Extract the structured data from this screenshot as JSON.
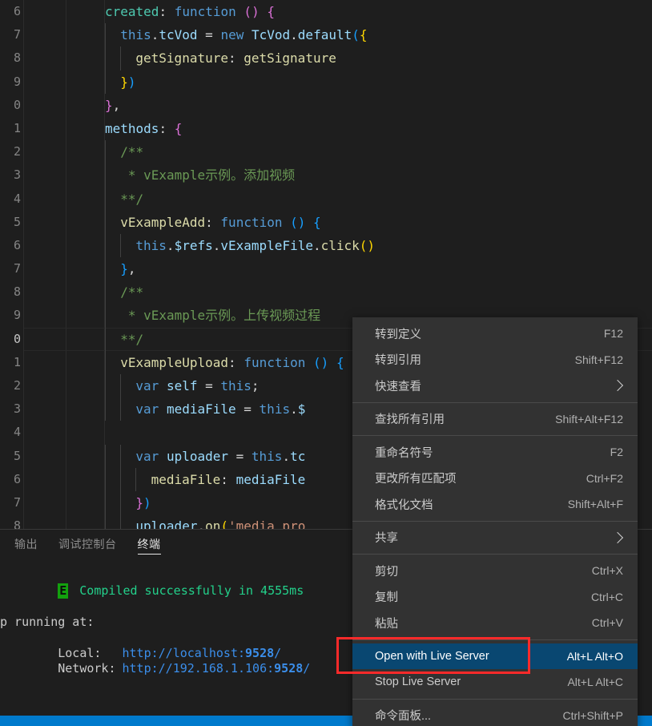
{
  "editor": {
    "language": "javascript",
    "lines": [
      {
        "num": "6",
        "indent": 0,
        "tokens": [
          {
            "t": "created",
            "c": "grn"
          },
          {
            "t": ":",
            "c": "pl"
          },
          {
            "t": " ",
            "c": "pl"
          },
          {
            "t": "function",
            "c": "kw"
          },
          {
            "t": " ",
            "c": "pl"
          },
          {
            "t": "(",
            "c": "p2"
          },
          {
            "t": ")",
            "c": "p2"
          },
          {
            "t": " ",
            "c": "pl"
          },
          {
            "t": "{",
            "c": "p2"
          }
        ]
      },
      {
        "num": "7",
        "indent": 1,
        "tokens": [
          {
            "t": "this",
            "c": "kw"
          },
          {
            "t": ".",
            "c": "pl"
          },
          {
            "t": "tcVod",
            "c": "key"
          },
          {
            "t": " = ",
            "c": "pl"
          },
          {
            "t": "new",
            "c": "kw"
          },
          {
            "t": " ",
            "c": "pl"
          },
          {
            "t": "TcVod",
            "c": "key"
          },
          {
            "t": ".",
            "c": "pl"
          },
          {
            "t": "default",
            "c": "key"
          },
          {
            "t": "(",
            "c": "p3"
          },
          {
            "t": "{",
            "c": "p1"
          }
        ]
      },
      {
        "num": "8",
        "indent": 2,
        "tokens": [
          {
            "t": "getSignature",
            "c": "fn"
          },
          {
            "t": ": ",
            "c": "pl"
          },
          {
            "t": "getSignature",
            "c": "fn"
          }
        ]
      },
      {
        "num": "9",
        "indent": 1,
        "tokens": [
          {
            "t": "}",
            "c": "p1"
          },
          {
            "t": ")",
            "c": "p3"
          }
        ]
      },
      {
        "num": "0",
        "indent": 0,
        "tokens": [
          {
            "t": "}",
            "c": "p2"
          },
          {
            "t": ",",
            "c": "pl"
          }
        ]
      },
      {
        "num": "1",
        "indent": 0,
        "tokens": [
          {
            "t": "methods",
            "c": "key"
          },
          {
            "t": ": ",
            "c": "pl"
          },
          {
            "t": "{",
            "c": "p2"
          }
        ]
      },
      {
        "num": "2",
        "indent": 1,
        "tokens": [
          {
            "t": "/**",
            "c": "cmt"
          }
        ]
      },
      {
        "num": "3",
        "indent": 1,
        "tokens": [
          {
            "t": " * vExample示例。添加视频",
            "c": "cmt"
          }
        ]
      },
      {
        "num": "4",
        "indent": 1,
        "tokens": [
          {
            "t": "**/",
            "c": "cmt"
          }
        ]
      },
      {
        "num": "5",
        "indent": 1,
        "tokens": [
          {
            "t": "vExampleAdd",
            "c": "fn"
          },
          {
            "t": ": ",
            "c": "pl"
          },
          {
            "t": "function",
            "c": "kw"
          },
          {
            "t": " ",
            "c": "pl"
          },
          {
            "t": "(",
            "c": "p3"
          },
          {
            "t": ")",
            "c": "p3"
          },
          {
            "t": " ",
            "c": "pl"
          },
          {
            "t": "{",
            "c": "p3"
          }
        ]
      },
      {
        "num": "6",
        "indent": 2,
        "tokens": [
          {
            "t": "this",
            "c": "kw"
          },
          {
            "t": ".",
            "c": "pl"
          },
          {
            "t": "$refs",
            "c": "key"
          },
          {
            "t": ".",
            "c": "pl"
          },
          {
            "t": "vExampleFile",
            "c": "key"
          },
          {
            "t": ".",
            "c": "pl"
          },
          {
            "t": "click",
            "c": "fn"
          },
          {
            "t": "(",
            "c": "p1"
          },
          {
            "t": ")",
            "c": "p1"
          }
        ]
      },
      {
        "num": "7",
        "indent": 1,
        "tokens": [
          {
            "t": "}",
            "c": "p3"
          },
          {
            "t": ",",
            "c": "pl"
          }
        ]
      },
      {
        "num": "8",
        "indent": 1,
        "tokens": [
          {
            "t": "/**",
            "c": "cmt"
          }
        ]
      },
      {
        "num": "9",
        "indent": 1,
        "tokens": [
          {
            "t": " * vExample示例。上传视频过程",
            "c": "cmt"
          }
        ]
      },
      {
        "num": "0",
        "indent": 1,
        "tokens": [
          {
            "t": "**/",
            "c": "cmt"
          }
        ],
        "current": true
      },
      {
        "num": "1",
        "indent": 1,
        "tokens": [
          {
            "t": "vExampleUpload",
            "c": "fn"
          },
          {
            "t": ": ",
            "c": "pl"
          },
          {
            "t": "function",
            "c": "kw"
          },
          {
            "t": " ",
            "c": "pl"
          },
          {
            "t": "(",
            "c": "p3"
          },
          {
            "t": ")",
            "c": "p3"
          },
          {
            "t": " ",
            "c": "pl"
          },
          {
            "t": "{",
            "c": "p3"
          }
        ]
      },
      {
        "num": "2",
        "indent": 2,
        "tokens": [
          {
            "t": "var",
            "c": "kw"
          },
          {
            "t": " ",
            "c": "pl"
          },
          {
            "t": "self",
            "c": "key"
          },
          {
            "t": " = ",
            "c": "pl"
          },
          {
            "t": "this",
            "c": "kw"
          },
          {
            "t": ";",
            "c": "pl"
          }
        ]
      },
      {
        "num": "3",
        "indent": 2,
        "tokens": [
          {
            "t": "var",
            "c": "kw"
          },
          {
            "t": " ",
            "c": "pl"
          },
          {
            "t": "mediaFile",
            "c": "key"
          },
          {
            "t": " = ",
            "c": "pl"
          },
          {
            "t": "this",
            "c": "kw"
          },
          {
            "t": ".",
            "c": "pl"
          },
          {
            "t": "$",
            "c": "key"
          }
        ]
      },
      {
        "num": "4",
        "indent": 0,
        "tokens": []
      },
      {
        "num": "5",
        "indent": 2,
        "tokens": [
          {
            "t": "var",
            "c": "kw"
          },
          {
            "t": " ",
            "c": "pl"
          },
          {
            "t": "uploader",
            "c": "key"
          },
          {
            "t": " = ",
            "c": "pl"
          },
          {
            "t": "this",
            "c": "kw"
          },
          {
            "t": ".",
            "c": "pl"
          },
          {
            "t": "tc",
            "c": "key"
          }
        ]
      },
      {
        "num": "6",
        "indent": 3,
        "tokens": [
          {
            "t": "mediaFile",
            "c": "fn"
          },
          {
            "t": ": ",
            "c": "pl"
          },
          {
            "t": "mediaFile",
            "c": "key"
          }
        ]
      },
      {
        "num": "7",
        "indent": 2,
        "tokens": [
          {
            "t": "}",
            "c": "p2"
          },
          {
            "t": ")",
            "c": "p3"
          }
        ]
      },
      {
        "num": "8",
        "indent": 2,
        "tokens": [
          {
            "t": "uploader",
            "c": "key"
          },
          {
            "t": ".",
            "c": "pl"
          },
          {
            "t": "on",
            "c": "fn"
          },
          {
            "t": "(",
            "c": "p1"
          },
          {
            "t": "'media_pro",
            "c": "str"
          }
        ]
      }
    ]
  },
  "panel": {
    "tabs": [
      {
        "label": "输出",
        "name": "tab-output",
        "active": false
      },
      {
        "label": "调试控制台",
        "name": "tab-debug-console",
        "active": false
      },
      {
        "label": "终端",
        "name": "tab-terminal",
        "active": true
      }
    ],
    "terminal": {
      "badge": "E",
      "compiled_message": "Compiled successfully in 4555ms",
      "running_line": "p running at:",
      "local_label": "Local:  ",
      "local_url_scheme": "http://localhost:",
      "local_port": "9528",
      "local_url_tail": "/",
      "network_label": "Network:",
      "network_url_scheme": "http://192.168.1.106:",
      "network_port": "9528",
      "network_url_tail": "/"
    }
  },
  "context_menu": {
    "groups": [
      {
        "items": [
          {
            "label": "转到定义",
            "key": "F12",
            "name": "menu-go-to-definition",
            "submenu": false,
            "selected": false
          },
          {
            "label": "转到引用",
            "key": "Shift+F12",
            "name": "menu-go-to-references",
            "submenu": false,
            "selected": false
          },
          {
            "label": "快速查看",
            "key": "",
            "name": "menu-peek",
            "submenu": true,
            "selected": false
          }
        ]
      },
      {
        "items": [
          {
            "label": "查找所有引用",
            "key": "Shift+Alt+F12",
            "name": "menu-find-all-references",
            "submenu": false,
            "selected": false
          }
        ]
      },
      {
        "items": [
          {
            "label": "重命名符号",
            "key": "F2",
            "name": "menu-rename-symbol",
            "submenu": false,
            "selected": false
          },
          {
            "label": "更改所有匹配项",
            "key": "Ctrl+F2",
            "name": "menu-change-all-occurrences",
            "submenu": false,
            "selected": false
          },
          {
            "label": "格式化文档",
            "key": "Shift+Alt+F",
            "name": "menu-format-document",
            "submenu": false,
            "selected": false
          }
        ]
      },
      {
        "items": [
          {
            "label": "共享",
            "key": "",
            "name": "menu-share",
            "submenu": true,
            "selected": false
          }
        ]
      },
      {
        "items": [
          {
            "label": "剪切",
            "key": "Ctrl+X",
            "name": "menu-cut",
            "submenu": false,
            "selected": false
          },
          {
            "label": "复制",
            "key": "Ctrl+C",
            "name": "menu-copy",
            "submenu": false,
            "selected": false
          },
          {
            "label": "粘贴",
            "key": "Ctrl+V",
            "name": "menu-paste",
            "submenu": false,
            "selected": false
          }
        ]
      },
      {
        "items": [
          {
            "label": "Open with Live Server",
            "key": "Alt+L Alt+O",
            "name": "menu-open-with-live-server",
            "submenu": false,
            "selected": true
          },
          {
            "label": "Stop Live Server",
            "key": "Alt+L Alt+C",
            "name": "menu-stop-live-server",
            "submenu": false,
            "selected": false
          }
        ]
      },
      {
        "items": [
          {
            "label": "命令面板...",
            "key": "Ctrl+Shift+P",
            "name": "menu-command-palette",
            "submenu": false,
            "selected": false
          }
        ]
      }
    ]
  },
  "annotation": {
    "highlight_target": "Open with Live Server",
    "color": "#fb2a2a"
  },
  "colors": {
    "editor_background": "#1e1e1e",
    "menu_background": "#323232",
    "menu_selected": "#094771",
    "statusbar": "#007acc",
    "terminal_green": "#23d18b",
    "terminal_blue": "#3b8eea",
    "annotation_red": "#fb2a2a"
  }
}
